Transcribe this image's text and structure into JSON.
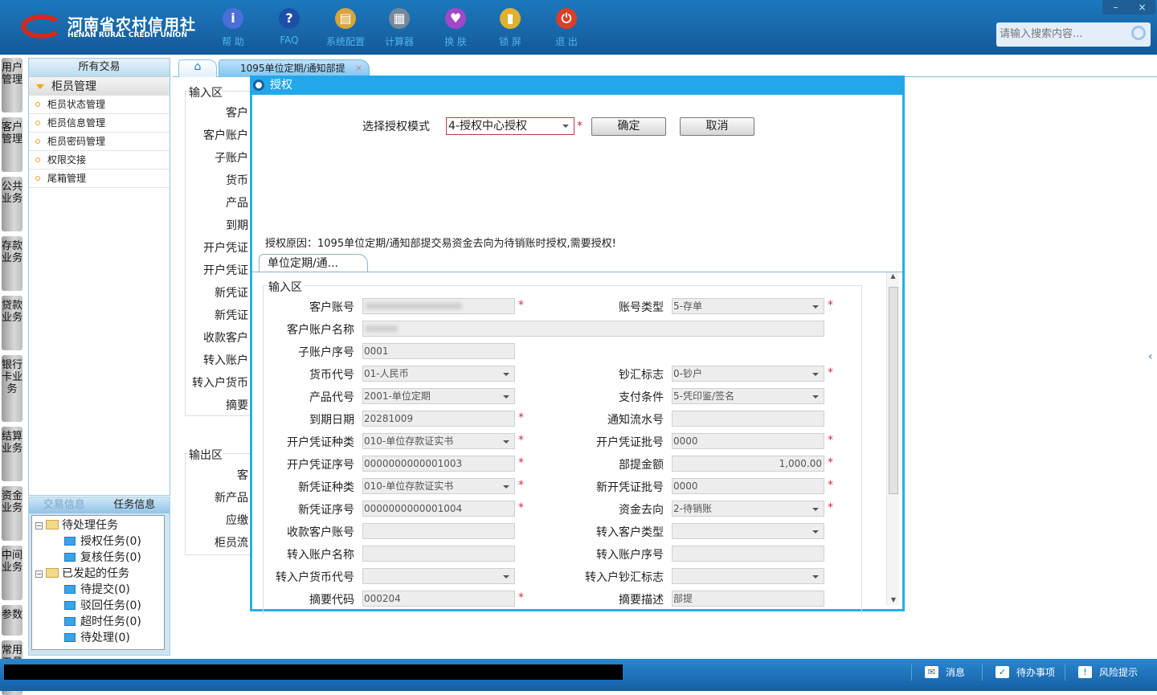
{
  "app": {
    "name_cn": "河南省农村信用社",
    "name_en": "HENAN RURAL CREDIT UNION"
  },
  "toolbar": [
    {
      "label": "帮 助",
      "icon": "info-icon",
      "color": "#4a6fd8",
      "glyph": "i"
    },
    {
      "label": "FAQ",
      "icon": "help-icon",
      "color": "#1c4fa8",
      "glyph": "?"
    },
    {
      "label": "系统配置",
      "icon": "toolbox-icon",
      "color": "#d9a53a",
      "glyph": "▤"
    },
    {
      "label": "计算器",
      "icon": "calculator-icon",
      "color": "#778899",
      "glyph": "▦"
    },
    {
      "label": "换 肤",
      "icon": "shirt-icon",
      "color": "#a048c8",
      "glyph": "♥"
    },
    {
      "label": "锁 屏",
      "icon": "lock-icon",
      "color": "#e0b030",
      "glyph": "▮"
    },
    {
      "label": "退 出",
      "icon": "power-icon",
      "color": "#d8402a",
      "glyph": "⏻"
    }
  ],
  "window": {
    "minimize": "–",
    "close": "×"
  },
  "search": {
    "placeholder": "请输入搜索内容..."
  },
  "vtabs": [
    "用户管理",
    "客户管理",
    "公共业务",
    "存款业务",
    "贷款业务",
    "银行卡业务",
    "结算业务",
    "资金业务",
    "中间业务",
    "参数",
    "常用工具"
  ],
  "nav": {
    "header": "所有交易",
    "group": "柜员管理",
    "items": [
      "柜员状态管理",
      "柜员信息管理",
      "柜员密码管理",
      "权限交接",
      "尾箱管理"
    ]
  },
  "tasks": {
    "tabs": [
      "交易信息",
      "任务信息"
    ],
    "tree": [
      {
        "label": "待处理任务",
        "level": 0
      },
      {
        "label": "授权任务(0)",
        "level": 1
      },
      {
        "label": "复核任务(0)",
        "level": 1
      },
      {
        "label": "已发起的任务",
        "level": 0
      },
      {
        "label": "待提交(0)",
        "level": 1
      },
      {
        "label": "驳回任务(0)",
        "level": 1
      },
      {
        "label": "超时任务(0)",
        "level": 1
      },
      {
        "label": "待处理(0)",
        "level": 1
      }
    ]
  },
  "tabs": {
    "active": "1095单位定期/通知部提",
    "close": "×"
  },
  "background_form": {
    "input_legend": "输入区",
    "input_labels": [
      "客户",
      "客户账户",
      "子账户",
      "货币",
      "产品",
      "到期",
      "开户凭证",
      "开户凭证",
      "新凭证",
      "新凭证",
      "收款客户",
      "转入账户",
      "转入户货币",
      "摘要"
    ],
    "output_legend": "输出区",
    "output_labels": [
      "客",
      "新产品",
      "应缴",
      "柜员流"
    ]
  },
  "dialog": {
    "title": "授权",
    "mode_label": "选择授权模式",
    "mode_value": "4-授权中心授权",
    "confirm": "确定",
    "cancel": "取消",
    "reason": "授权原因：1095单位定期/通知部提交易资金去向为待销账时授权,需要授权!",
    "subtab": "单位定期/通...",
    "legend": "输入区",
    "rows": [
      [
        {
          "label": "客户账号",
          "value": "",
          "blur": true,
          "req": true
        },
        {
          "label": "账号类型",
          "value": "5-存单",
          "select": true,
          "req": true
        }
      ],
      [
        {
          "label": "客户账户名称",
          "value": "",
          "blur": true,
          "wide": true
        },
        null
      ],
      [
        {
          "label": "子账户序号",
          "value": "0001"
        },
        null
      ],
      [
        {
          "label": "货币代号",
          "value": "01-人民币",
          "select": true
        },
        {
          "label": "钞汇标志",
          "value": "0-钞户",
          "select": true,
          "req": true
        }
      ],
      [
        {
          "label": "产品代号",
          "value": "2001-单位定期",
          "select": true
        },
        {
          "label": "支付条件",
          "value": "5-凭印鉴/签名",
          "select": true
        }
      ],
      [
        {
          "label": "到期日期",
          "value": "20281009",
          "req": true
        },
        {
          "label": "通知流水号",
          "value": ""
        }
      ],
      [
        {
          "label": "开户凭证种类",
          "value": "010-单位存款证实书",
          "select": true,
          "req": true
        },
        {
          "label": "开户凭证批号",
          "value": "0000",
          "req": true
        }
      ],
      [
        {
          "label": "开户凭证序号",
          "value": "0000000000001003",
          "req": true
        },
        {
          "label": "部提金额",
          "value": "1,000.00",
          "req": true,
          "right": true
        }
      ],
      [
        {
          "label": "新凭证种类",
          "value": "010-单位存款证实书",
          "select": true,
          "req": true
        },
        {
          "label": "新开凭证批号",
          "value": "0000",
          "req": true
        }
      ],
      [
        {
          "label": "新凭证序号",
          "value": "0000000000001004",
          "req": true
        },
        {
          "label": "资金去向",
          "value": "2-待销账",
          "select": true,
          "req": true
        }
      ],
      [
        {
          "label": "收款客户账号",
          "value": ""
        },
        {
          "label": "转入客户类型",
          "value": "",
          "select": true
        }
      ],
      [
        {
          "label": "转入账户名称",
          "value": ""
        },
        {
          "label": "转入账户序号",
          "value": ""
        }
      ],
      [
        {
          "label": "转入户货币代号",
          "value": "",
          "select": true
        },
        {
          "label": "转入户钞汇标志",
          "value": "",
          "select": true
        }
      ],
      [
        {
          "label": "摘要代码",
          "value": "000204",
          "req": true
        },
        {
          "label": "摘要描述",
          "value": "部提"
        }
      ]
    ],
    "required_mark": "*"
  },
  "status": {
    "items": [
      {
        "label": "消息",
        "icon": "mail-icon",
        "glyph": "✉"
      },
      {
        "label": "待办事项",
        "icon": "checkbox-icon",
        "glyph": "✓"
      },
      {
        "label": "风险提示",
        "icon": "alert-bubble-icon",
        "glyph": "!"
      }
    ]
  }
}
